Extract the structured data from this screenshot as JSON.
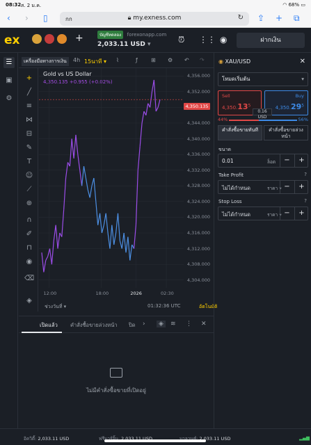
{
  "status": {
    "time": "08:32",
    "date": "ส. 2 ม.ค.",
    "battery": "68%"
  },
  "browser": {
    "aa": "กก",
    "url": "my.exness.com"
  },
  "header": {
    "logo": "ex",
    "account_tag": "บัญชีทดลอง",
    "server": "forexonapp.com",
    "balance": "2,033.11 USD",
    "deposit_label": "ฝากเงิน"
  },
  "chart_toolbar": {
    "title": "เครื่องมือทางการเงิน",
    "tf1": "4h",
    "tf2": "15นาที"
  },
  "chart": {
    "symbol_name": "Gold vs US Dollar",
    "ohlc": "4,350.135 +0.955 (+0.02%)",
    "price_tag": "4,350.135",
    "range_label": "ช่วงวันที่",
    "clock": "01:32:36 UTC",
    "auto_label": "อัตโนมัติ"
  },
  "chart_data": {
    "type": "line",
    "title": "Gold vs US Dollar",
    "xlabel": "",
    "ylabel": "",
    "x_ticks": [
      "12:00",
      "18:00",
      "2026",
      "02:30"
    ],
    "y_ticks": [
      4304,
      4308,
      4312,
      4316,
      4320,
      4324,
      4328,
      4332,
      4336,
      4340,
      4344,
      4348,
      4352,
      4356
    ],
    "y_tick_labels": [
      "4,304.000",
      "4,308.000",
      "4,312.000",
      "4,316.000",
      "4,320.000",
      "4,324.000",
      "4,328.000",
      "4,332.000",
      "4,336.000",
      "4,340.000",
      "4,344.000",
      "4,348.000",
      "4,352.000",
      "4,356.000"
    ],
    "ylim": [
      4302,
      4358
    ],
    "grid": true,
    "series": [
      {
        "color_up": "#9b4de8",
        "color_down": "#4c8fe3",
        "values": [
          4311,
          4306,
          4309,
          4310,
          4312,
          4308,
          4314,
          4318,
          4312,
          4316,
          4315,
          4322,
          4330,
          4334,
          4333,
          4340,
          4335,
          4341,
          4336,
          4332,
          4328,
          4333,
          4330,
          4327,
          4325,
          4328,
          4330,
          4324,
          4318,
          4321,
          4316,
          4318,
          4321,
          4316,
          4312,
          4318,
          4313,
          4316,
          4321,
          4314,
          4312,
          4316,
          4311,
          4315,
          4309,
          4313,
          4312,
          4318,
          4332,
          4338,
          4344,
          4347,
          4346,
          4349,
          4348,
          4352,
          4355,
          4347,
          4348,
          4350
        ]
      }
    ]
  },
  "orders": {
    "tab_open": "เปิดแล้ว",
    "tab_pending": "คำสั่งซื้อขายล่วงหน้า",
    "tab_closed": "ปิด",
    "empty": "ไม่มีคำสั่งซื้อขายที่เปิดอยู่"
  },
  "footer": {
    "equity_label": "อิควิตี้:",
    "equity": "2,033.11 USD",
    "free_label": "ฟรีมาร์จิ้น:",
    "free": "2,033.11 USD",
    "balance_label": "บาลานซ์:",
    "balance": "2,033.11 USD"
  },
  "panel": {
    "symbol": "XAU/USD",
    "mode": "โหมดเริ่มต้น",
    "sell_label": "Sell",
    "sell_price_a": "4,350.",
    "sell_price_b": "13",
    "sell_price_c": "5",
    "buy_label": "Buy",
    "buy_price_a": "4,350.",
    "buy_price_b": "29",
    "buy_price_c": "5",
    "spread": "0.16 USD",
    "sell_pct": "44%",
    "buy_pct": "56%",
    "sell_ratio": 0.44,
    "type_market": "คำสั่งซื้อขายทันที",
    "type_pending": "คำสั่งซื้อขายล่วงหน้า",
    "size_label": "ขนาด",
    "size_value": "0.01",
    "size_unit": "ล็อต",
    "tp_label": "Take Profit",
    "tp_value": "ไม่ได้กำหนด",
    "tp_unit": "ราคา",
    "sl_label": "Stop Loss",
    "sl_value": "ไม่ได้กำหนด",
    "sl_unit": "ราคา"
  }
}
